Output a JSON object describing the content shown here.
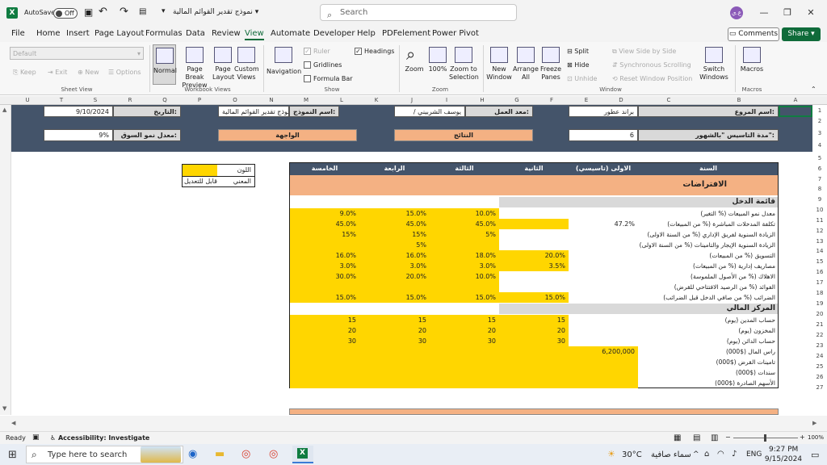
{
  "titlebar": {
    "autosave_label": "AutoSave",
    "autosave_state": "Off",
    "doc_title": "نموذج تقدير القوائم المالية",
    "search_placeholder": "Search",
    "avatar_initials": "ع.ي"
  },
  "menu": {
    "items": [
      "File",
      "Home",
      "Insert",
      "Page Layout",
      "Formulas",
      "Data",
      "Review",
      "View",
      "Automate",
      "Developer",
      "Help",
      "PDFelement",
      "Power Pivot"
    ],
    "active": "View",
    "comments": "Comments",
    "share": "Share"
  },
  "ribbon": {
    "sheet_view": {
      "dropdown": "Default",
      "keep": "Keep",
      "exit": "Exit",
      "new": "New",
      "options": "Options",
      "label": "Sheet View"
    },
    "workbook_views": {
      "normal": "Normal",
      "page_break": "Page Break Preview",
      "page_layout": "Page Layout",
      "custom": "Custom Views",
      "label": "Workbook Views"
    },
    "show": {
      "navigation": "Navigation",
      "ruler": "Ruler",
      "gridlines": "Gridlines",
      "formula_bar": "Formula Bar",
      "headings": "Headings",
      "label": "Show"
    },
    "zoom": {
      "zoom": "Zoom",
      "hundred": "100%",
      "zoom_sel": "Zoom to Selection",
      "label": "Zoom"
    },
    "window": {
      "new_window": "New Window",
      "arrange_all": "Arrange All",
      "freeze": "Freeze Panes",
      "split": "Split",
      "hide": "Hide",
      "unhide": "Unhide",
      "side_by_side": "View Side by Side",
      "sync_scroll": "Synchronous Scrolling",
      "reset_pos": "Reset Window Position",
      "switch": "Switch Windows",
      "label": "Window"
    },
    "macros": {
      "macros": "Macros",
      "label": "Macros"
    }
  },
  "columns": [
    "U",
    "T",
    "S",
    "R",
    "Q",
    "P",
    "O",
    "N",
    "M",
    "L",
    "K",
    "J",
    "I",
    "H",
    "G",
    "F",
    "E",
    "D",
    "C",
    "B",
    "A"
  ],
  "rows": [
    "1",
    "2",
    "3",
    "4",
    "5",
    "6",
    "7",
    "8",
    "9",
    "10",
    "11",
    "12",
    "13",
    "14",
    "15",
    "16",
    "17",
    "18",
    "19",
    "20",
    "21",
    "22",
    "23",
    "24",
    "25",
    "26",
    "27"
  ],
  "header": {
    "date_label": "التاريخ:",
    "date_value": "9/10/2024",
    "model_label": "اسم النموذج:",
    "model_value": "نموذج تقدير القوائم المالية",
    "preparer_label": "معد العمل:",
    "preparer_value": "/ يوسف الشربيني",
    "project_label": "اسم المروع:",
    "project_value": "براند عطور",
    "growth_label": "معدل نمو السوق:",
    "growth_value": "9%",
    "interface": "الواجهة",
    "results": "النتائج",
    "duration_label": "مدة التاسيس \"بالشهور\":",
    "duration_value": "6"
  },
  "legend": {
    "color": "اللون",
    "meaning": "المعني",
    "editable": "قابل للتعديل"
  },
  "table": {
    "col_heads": [
      "السنة",
      "الاولى (تاسيسي)",
      "الثانية",
      "الثالثة",
      "الرابعة",
      "الخامسة"
    ],
    "assumptions": "الافتراضات",
    "income_section": "قائمة الدخل",
    "income_rows": [
      {
        "label": "معدل نمو المبيعات (% التغير)",
        "v": [
          "",
          "",
          "10.0%",
          "15.0%",
          "9.0%"
        ]
      },
      {
        "label": "تكلفة المدخلات المباشرة (% من المبيعات)",
        "v": [
          "47.2%",
          "",
          "45.0%",
          "45.0%",
          "45.0%"
        ]
      },
      {
        "label": "الزيادة السنوية لفريق الإداري (% من السنة الاولى)",
        "v": [
          "",
          "",
          "5%",
          "15%",
          "15%"
        ]
      },
      {
        "label": "الزيادة السنوية الإيجار والتامينات (% من السنة الاولى)",
        "v": [
          "",
          "",
          "",
          "5%",
          ""
        ]
      },
      {
        "label": "التسويق (% من المبيعات)",
        "v": [
          "",
          "20.0%",
          "18.0%",
          "16.0%",
          "16.0%"
        ]
      },
      {
        "label": "مصاريف إدارية (% من المبيعات)",
        "v": [
          "",
          "3.5%",
          "3.0%",
          "3.0%",
          "3.0%"
        ]
      },
      {
        "label": "الاهلاك (% من الأصول الملموسة)",
        "v": [
          "",
          "",
          "10.0%",
          "20.0%",
          "30.0%"
        ]
      },
      {
        "label": "الفوائد (% من الرصيد الافتتاحي للقرض)",
        "v": [
          "",
          "",
          "",
          "",
          ""
        ]
      },
      {
        "label": "الضرائب (% من صافي الدخل قبل الضرائب)",
        "v": [
          "",
          "15.0%",
          "15.0%",
          "15.0%",
          "15.0%"
        ]
      }
    ],
    "finance_section": "المركز المالي",
    "finance_rows": [
      {
        "label": "حساب المدين (يوم)",
        "v": [
          "",
          "15",
          "15",
          "15",
          "15"
        ]
      },
      {
        "label": "المخزون (يوم)",
        "v": [
          "",
          "20",
          "20",
          "20",
          "20"
        ]
      },
      {
        "label": "حساب الدائن (يوم)",
        "v": [
          "",
          "30",
          "30",
          "30",
          "30"
        ]
      },
      {
        "label": "راس المال ($000)",
        "v": [
          "6,200,000",
          "",
          "",
          "",
          ""
        ]
      },
      {
        "label": "تامينات القرض ($000)",
        "v": [
          "",
          "",
          "",
          "",
          ""
        ]
      },
      {
        "label": "سندات ($000)",
        "v": [
          "",
          "",
          "",
          "",
          ""
        ]
      },
      {
        "label": "الأسهم الصادرة ($000)",
        "v": [
          "",
          "",
          "",
          "",
          ""
        ]
      }
    ]
  },
  "status": {
    "ready": "Ready",
    "accessibility": "Accessibility: Investigate",
    "zoom": "100%"
  },
  "taskbar": {
    "search": "Type here to search",
    "temp": "30°C",
    "weather": "سماء صافية",
    "lang": "ENG",
    "time": "9:27 PM",
    "date": "9/15/2024"
  },
  "colors": {
    "excel_green": "#107c41",
    "navy": "#44546a",
    "yellow": "#ffd600",
    "orange": "#f4b183"
  }
}
